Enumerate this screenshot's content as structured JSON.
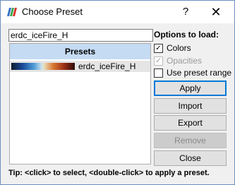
{
  "window": {
    "title": "Choose Preset",
    "help_label": "?",
    "close_label": "✕"
  },
  "search": {
    "value": "erdc_iceFire_H",
    "placeholder": ""
  },
  "presets": {
    "header": "Presets",
    "items": [
      {
        "name": "erdc_iceFire_H",
        "swatch_colors": [
          "#0d1b2e",
          "#1c4a9a",
          "#4f9fd8",
          "#cfe3ee",
          "#e9dbb8",
          "#d8772f",
          "#9c2e17",
          "#2a0a06"
        ]
      }
    ]
  },
  "options": {
    "label": "Options to load:",
    "checkboxes": [
      {
        "label": "Colors",
        "checked": true,
        "enabled": true
      },
      {
        "label": "Opacities",
        "checked": true,
        "enabled": false
      },
      {
        "label": "Use preset range",
        "checked": false,
        "enabled": true
      }
    ]
  },
  "buttons": {
    "apply": "Apply",
    "import": "Import",
    "export": "Export",
    "remove": "Remove",
    "close": "Close"
  },
  "tip": "Tip: <click> to select, <double-click> to apply a preset.",
  "colors": {
    "header_bg": "#c5dbf3",
    "selected_row_bg": "#e5e5e5",
    "button_bg": "#e1e1e1",
    "focus_border": "#0078d7"
  }
}
